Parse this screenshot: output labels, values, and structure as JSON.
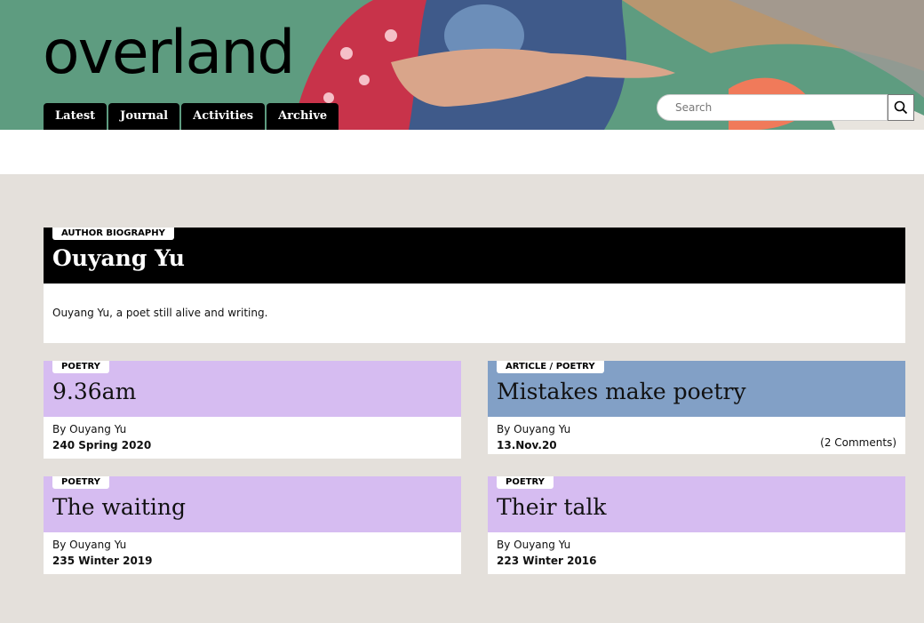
{
  "header": {
    "logo_text": "overland",
    "nav": [
      "Latest",
      "Journal",
      "Activities",
      "Archive"
    ],
    "search_placeholder": "Search"
  },
  "bio": {
    "tag": "AUTHOR BIOGRAPHY",
    "name": "Ouyang Yu",
    "text": "Ouyang Yu, a poet still alive and writing."
  },
  "articles": [
    {
      "tag": "POETRY",
      "title": "9.36am",
      "byline": "By Ouyang Yu",
      "issue": "240 Spring 2020",
      "comments": "",
      "color": "#d6bcf1"
    },
    {
      "tag": "ARTICLE / POETRY",
      "title": "Mistakes make poetry",
      "byline": "By Ouyang Yu",
      "issue": "13.Nov.20",
      "comments": "(2 Comments)",
      "color": "#82a0c6"
    },
    {
      "tag": "POETRY",
      "title": "The waiting",
      "byline": "By Ouyang Yu",
      "issue": "235 Winter 2019",
      "comments": "",
      "color": "#d6bcf1"
    },
    {
      "tag": "POETRY",
      "title": "Their talk",
      "byline": "By Ouyang Yu",
      "issue": "223 Winter 2016",
      "comments": "",
      "color": "#d6bcf1"
    }
  ],
  "colors": {
    "header_bg": "#5e9c80",
    "page_bg": "#e4e0db",
    "poetry": "#d6bcf1",
    "article": "#82a0c6"
  }
}
